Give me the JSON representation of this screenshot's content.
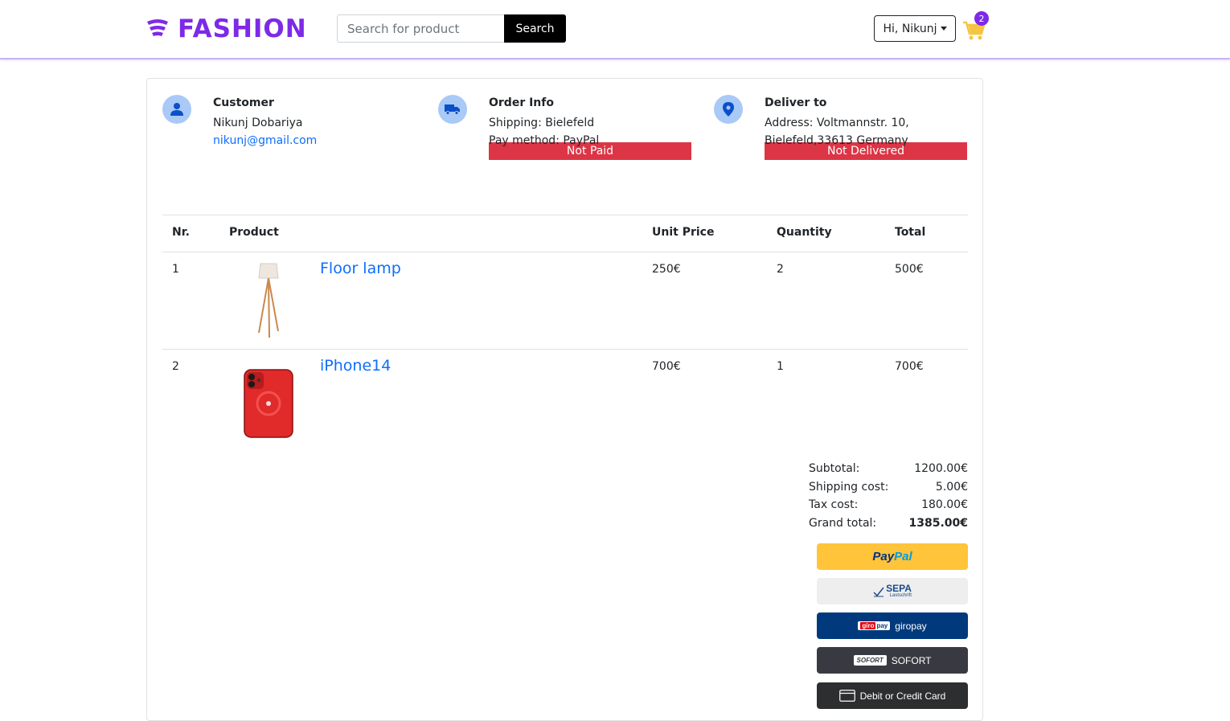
{
  "header": {
    "brand": "FASHION",
    "search_placeholder": "Search for product",
    "search_button": "Search",
    "user_greeting": "Hi, Nikunj",
    "cart_count": "2"
  },
  "customer": {
    "title": "Customer",
    "name": "Nikunj Dobariya",
    "email": "nikunj@gmail.com"
  },
  "order_info": {
    "title": "Order Info",
    "shipping": "Shipping: Bielefeld",
    "pay_method": "Pay method: PayPal",
    "payment_status": "Not Paid"
  },
  "deliver_to": {
    "title": "Deliver to",
    "address_line1": "Address: Voltmannstr. 10,",
    "address_line2": "Bielefeld,33613 Germany",
    "delivery_status": "Not Delivered"
  },
  "table": {
    "headers": [
      "Nr.",
      "Product",
      "Unit Price",
      "Quantity",
      "Total"
    ],
    "rows": [
      {
        "nr": "1",
        "product": "Floor lamp",
        "unit_price": "250€",
        "quantity": "2",
        "total": "500€"
      },
      {
        "nr": "2",
        "product": "iPhone14",
        "unit_price": "700€",
        "quantity": "1",
        "total": "700€"
      }
    ]
  },
  "totals": {
    "subtotal_label": "Subtotal:",
    "subtotal": "1200.00€",
    "shipping_label": "Shipping cost:",
    "shipping": "5.00€",
    "tax_label": "Tax cost:",
    "tax": "180.00€",
    "grand_label": "Grand total:",
    "grand": "1385.00€"
  },
  "payment": {
    "paypal_1": "Pay",
    "paypal_2": "Pal",
    "sepa_big": "SEPA",
    "sepa_small": "Lastschrift",
    "giro_logo_1": "giro",
    "giro_logo_2": "pay",
    "giro_label": "giropay",
    "sofort_logo": "SOFORT",
    "sofort_label": "SOFORT",
    "card_label": "Debit or Credit Card"
  },
  "colors": {
    "brand": "#7d2ae8",
    "danger": "#dc3545",
    "link": "#0d6efd"
  }
}
